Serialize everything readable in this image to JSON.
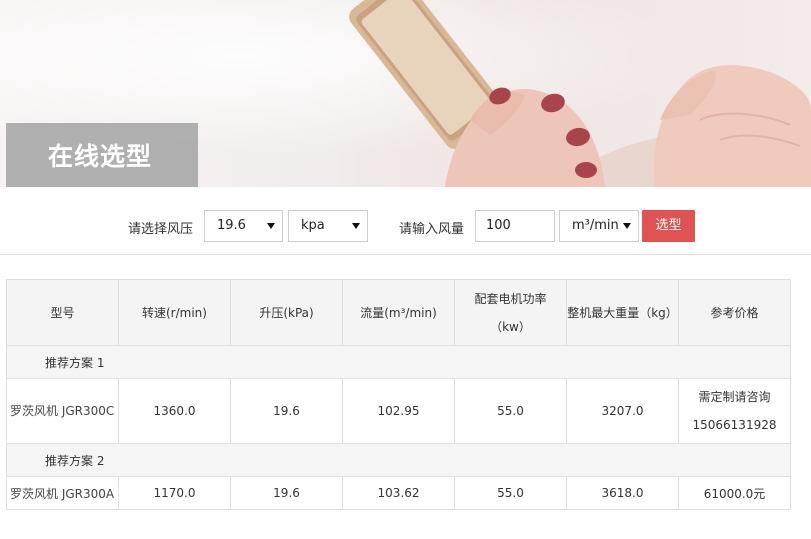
{
  "banner": {
    "title": "在线选型"
  },
  "controls": {
    "pressure_label": "请选择风压",
    "pressure_value": "19.6",
    "pressure_unit": "kpa",
    "flow_label": "请输入风量",
    "flow_value": "100",
    "flow_unit": "m³/min",
    "submit_label": "选型"
  },
  "table": {
    "headers": [
      "型号",
      "转速(r/min)",
      "升压(kPa)",
      "流量(m³/min)",
      "配套电机功率",
      "（kw）",
      "整机最大重量（kg）",
      "参考价格"
    ],
    "groups": [
      {
        "label": "推荐方案 1",
        "row": {
          "model": "罗茨风机 JGR300C",
          "speed": "1360.0",
          "pressure": "19.6",
          "flow": "102.95",
          "power": "55.0",
          "weight": "3207.0",
          "price_line1": "需定制请咨询",
          "price_line2": "15066131928"
        }
      },
      {
        "label": "推荐方案 2",
        "row": {
          "model": "罗茨风机 JGR300A",
          "speed": "1170.0",
          "pressure": "19.6",
          "flow": "103.62",
          "power": "55.0",
          "weight": "3618.0",
          "price_line1": "61000.0元"
        }
      }
    ]
  }
}
